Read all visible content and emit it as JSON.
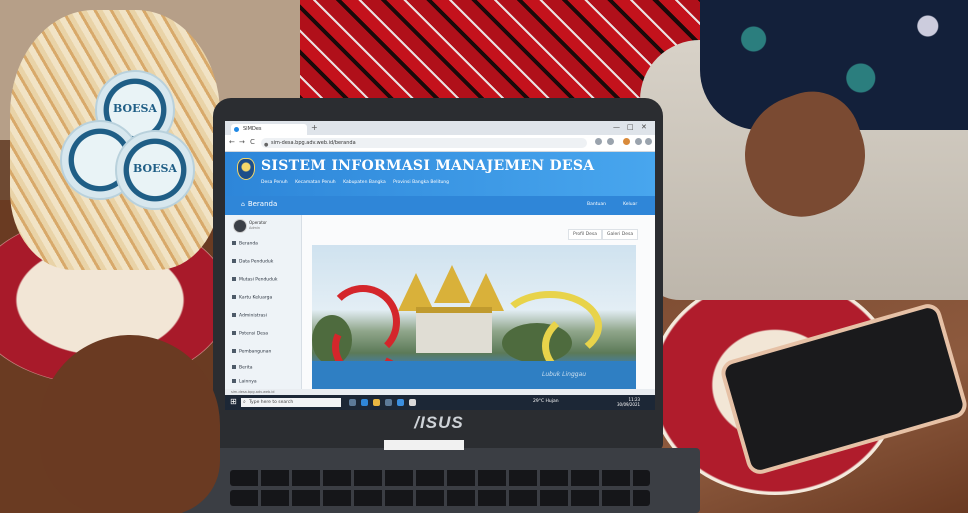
{
  "browser": {
    "tab_title": "SIMDes",
    "new_tab": "+",
    "url": "sim-desa.bpg.adv.web.id/beranda",
    "nav_back": "←",
    "nav_forward": "→",
    "nav_reload": "C",
    "win_min": "—",
    "win_max": "□",
    "win_close": "✕"
  },
  "site": {
    "title": "SISTEM INFORMASI MANAJEMEN DESA",
    "subtitle_parts": [
      "Desa Penuh",
      "Kecamatan Penuh",
      "Kabupaten Bangka",
      "Provinsi Bangka Belitung"
    ]
  },
  "navbar": {
    "home_label": "Beranda",
    "right_items": [
      "Bantuan",
      "Keluar"
    ]
  },
  "sidebar": {
    "user_name": "Operator",
    "user_role": "Admin",
    "items": [
      {
        "label": "Beranda"
      },
      {
        "label": "Data Penduduk"
      },
      {
        "label": "Mutasi Penduduk"
      },
      {
        "label": "Kartu Keluarga"
      },
      {
        "label": "Administrasi"
      },
      {
        "label": "Potensi Desa"
      },
      {
        "label": "Pembangunan"
      },
      {
        "label": "Berita"
      },
      {
        "label": "Lainnya"
      }
    ]
  },
  "content": {
    "tabs": [
      "Profil Desa",
      "Galeri Desa"
    ],
    "photo_watermark": "Lubuk Linggau"
  },
  "statusbar": {
    "text": "sim-desa.bpg.adv.web.id"
  },
  "taskbar": {
    "search_placeholder": "Type here to search",
    "weather": "29°C Hujan",
    "time": "11:23",
    "date": "30/09/2021"
  },
  "laptop": {
    "brand": "/ISUS"
  },
  "background": {
    "cup_label": "BOESA"
  },
  "colors": {
    "header_blue": "#2d86d9",
    "navbar_blue": "#2f86d8",
    "sidebar_bg": "#eef3f7"
  }
}
